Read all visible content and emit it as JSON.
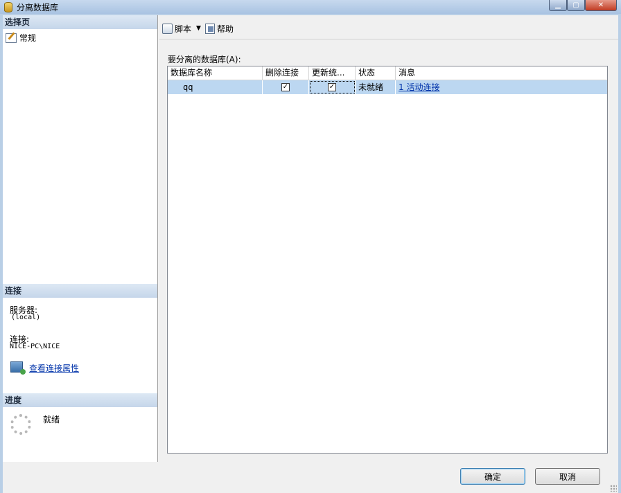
{
  "window": {
    "title": "分离数据库"
  },
  "left": {
    "select_page_header": "选择页",
    "pages": [
      "常规"
    ],
    "connection_header": "连接",
    "server_label": "服务器:",
    "server_value": "(local)",
    "connection_label": "连接:",
    "connection_value": "NICE-PC\\NICE",
    "view_link": "查看连接属性",
    "progress_header": "进度",
    "progress_status": "就绪"
  },
  "toolbar": {
    "script_label": "脚本",
    "help_label": "帮助"
  },
  "grid": {
    "label": "要分离的数据库(A):",
    "columns": [
      "数据库名称",
      "删除连接",
      "更新统...",
      "状态",
      "消息"
    ],
    "rows": [
      {
        "name": "qq",
        "drop_connections": true,
        "update_stats": true,
        "status": "未就绪",
        "message": "1 活动连接"
      }
    ]
  },
  "buttons": {
    "ok": "确定",
    "cancel": "取消"
  }
}
